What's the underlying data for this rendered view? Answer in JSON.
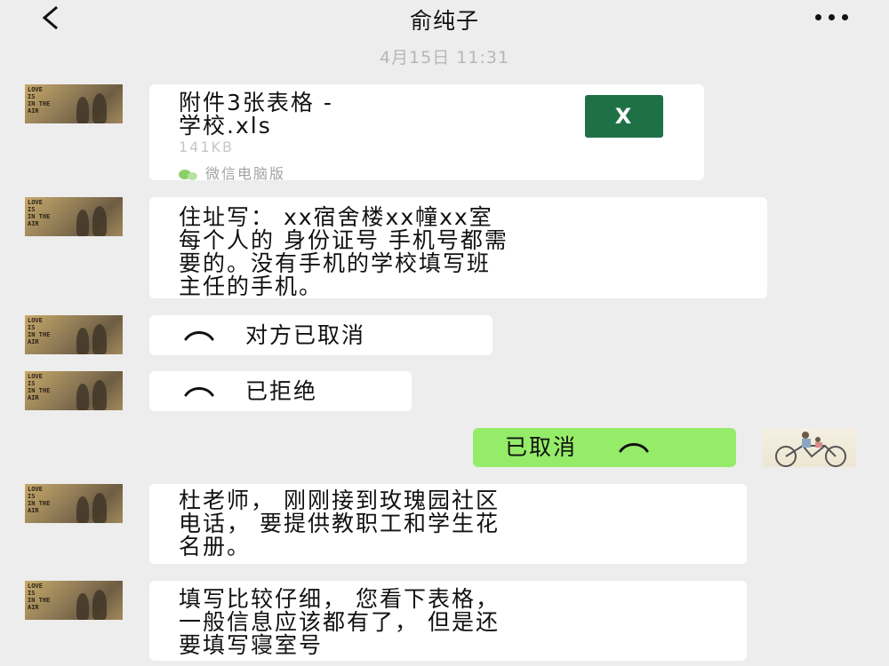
{
  "header": {
    "title": "俞纯子",
    "back_icon": "chevron-left-icon",
    "more_icon": "ellipsis-icon"
  },
  "timestamp": "4月15日 11:31",
  "avatar_text": [
    "LOVE",
    "IS",
    "IN THE",
    "AIR"
  ],
  "messages": [
    {
      "type": "file",
      "file_name_line1": "附件3张表格 -",
      "file_name_line2": "学校.xls",
      "file_size": "141KB",
      "file_icon_label": "X",
      "source": "微信电脑版"
    },
    {
      "type": "text",
      "lines": [
        "住址写： xx宿舍楼xx幢xx室",
        "每个人的 身份证号 手机号都需",
        "要的。没有手机的学校填写班",
        "主任的手机。"
      ]
    },
    {
      "type": "call",
      "text": "对方已取消"
    },
    {
      "type": "call",
      "text": "已拒绝"
    },
    {
      "type": "call_self",
      "text": "已取消"
    },
    {
      "type": "text",
      "lines": [
        "杜老师， 刚刚接到玫瑰园社区",
        "电话， 要提供教职工和学生花",
        "名册。"
      ]
    },
    {
      "type": "text",
      "lines": [
        "填写比较仔细， 您看下表格，",
        "一般信息应该都有了， 但是还",
        "要填写寝室号"
      ]
    }
  ]
}
